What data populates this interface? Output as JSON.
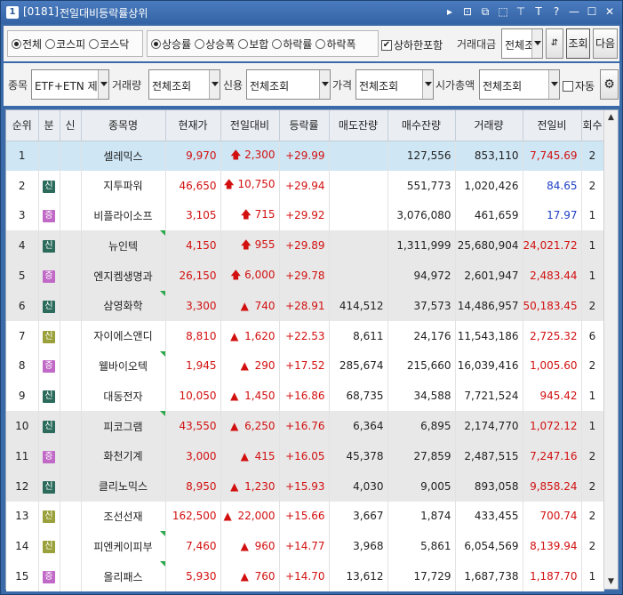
{
  "window": {
    "num": "1",
    "code": "[0181]",
    "title": "전일대비등락률상위"
  },
  "title_icons": [
    "▸",
    "⊡",
    "⧉",
    "⬚",
    "⊤",
    "T",
    "?",
    "—",
    "☐",
    "✕"
  ],
  "market_radios": [
    {
      "label": "전체",
      "on": true
    },
    {
      "label": "코스피",
      "on": false
    },
    {
      "label": "코스닥",
      "on": false
    }
  ],
  "sort_radios": [
    {
      "label": "상승률",
      "on": true
    },
    {
      "label": "상승폭",
      "on": false
    },
    {
      "label": "보합",
      "on": false
    },
    {
      "label": "하락률",
      "on": false
    },
    {
      "label": "하락폭",
      "on": false
    }
  ],
  "include_limit_label": "상하한포함",
  "trade_value_label": "거래대금",
  "trade_value_select": "전체조",
  "search_button": "조회",
  "next_button": "다음",
  "filters": {
    "item_label": "종목",
    "item_value": "ETF+ETN 제외",
    "volume_label": "거래량",
    "volume_value": "전체조회",
    "credit_label": "신용",
    "credit_value": "전체조회",
    "price_label": "가격",
    "price_value": "전체조회",
    "cap_label": "시가총액",
    "cap_value": "전체조회",
    "auto_label": "자동"
  },
  "columns": [
    "순위",
    "분",
    "신",
    "종목명",
    "현재가",
    "전일대비",
    "등락률",
    "매도잔량",
    "매수잔량",
    "거래량",
    "전일비",
    "회수"
  ],
  "rows": [
    {
      "rank": "1",
      "badge": "",
      "name": "셀레믹스",
      "flag": false,
      "price": "9,970",
      "arrow": "up",
      "change": "2,300",
      "rate": "+29.99",
      "ask": "",
      "bid": "127,556",
      "volume": "853,110",
      "prev": "7,745.69",
      "prev_up": true,
      "count": "2"
    },
    {
      "rank": "2",
      "badge": "신",
      "name": "지투파워",
      "flag": false,
      "price": "46,650",
      "arrow": "up",
      "change": "10,750",
      "rate": "+29.94",
      "ask": "",
      "bid": "551,773",
      "volume": "1,020,426",
      "prev": "84.65",
      "prev_up": false,
      "count": "2"
    },
    {
      "rank": "3",
      "badge": "증",
      "name": "비플라이소프",
      "flag": false,
      "price": "3,105",
      "arrow": "up",
      "change": "715",
      "rate": "+29.92",
      "ask": "",
      "bid": "3,076,080",
      "volume": "461,659",
      "prev": "17.97",
      "prev_up": false,
      "count": "1"
    },
    {
      "rank": "4",
      "badge": "신",
      "name": "뉴인텍",
      "flag": true,
      "price": "4,150",
      "arrow": "up",
      "change": "955",
      "rate": "+29.89",
      "ask": "",
      "bid": "1,311,999",
      "volume": "25,680,904",
      "prev": "24,021.72",
      "prev_up": true,
      "count": "1"
    },
    {
      "rank": "5",
      "badge": "증",
      "name": "엔지켐생명과",
      "flag": false,
      "price": "26,150",
      "arrow": "up",
      "change": "6,000",
      "rate": "+29.78",
      "ask": "",
      "bid": "94,972",
      "volume": "2,601,947",
      "prev": "2,483.44",
      "prev_up": true,
      "count": "1"
    },
    {
      "rank": "6",
      "badge": "신",
      "name": "삼영화학",
      "flag": true,
      "price": "3,300",
      "arrow": "tri",
      "change": "740",
      "rate": "+28.91",
      "ask": "414,512",
      "bid": "37,573",
      "volume": "14,486,957",
      "prev": "50,183.45",
      "prev_up": true,
      "count": "2"
    },
    {
      "rank": "7",
      "badge": "신y",
      "name": "자이에스앤디",
      "flag": false,
      "price": "8,810",
      "arrow": "tri",
      "change": "1,620",
      "rate": "+22.53",
      "ask": "8,611",
      "bid": "24,176",
      "volume": "11,543,186",
      "prev": "2,725.32",
      "prev_up": true,
      "count": "6"
    },
    {
      "rank": "8",
      "badge": "증",
      "name": "웰바이오텍",
      "flag": true,
      "price": "1,945",
      "arrow": "tri",
      "change": "290",
      "rate": "+17.52",
      "ask": "285,674",
      "bid": "215,660",
      "volume": "16,039,416",
      "prev": "1,005.60",
      "prev_up": true,
      "count": "2"
    },
    {
      "rank": "9",
      "badge": "신",
      "name": "대동전자",
      "flag": false,
      "price": "10,050",
      "arrow": "tri",
      "change": "1,450",
      "rate": "+16.86",
      "ask": "68,735",
      "bid": "34,588",
      "volume": "7,721,524",
      "prev": "945.42",
      "prev_up": true,
      "count": "1"
    },
    {
      "rank": "10",
      "badge": "신",
      "name": "피코그램",
      "flag": true,
      "price": "43,550",
      "arrow": "tri",
      "change": "6,250",
      "rate": "+16.76",
      "ask": "6,364",
      "bid": "6,895",
      "volume": "2,174,770",
      "prev": "1,072.12",
      "prev_up": true,
      "count": "1"
    },
    {
      "rank": "11",
      "badge": "증",
      "name": "화천기계",
      "flag": false,
      "price": "3,000",
      "arrow": "tri",
      "change": "415",
      "rate": "+16.05",
      "ask": "45,378",
      "bid": "27,859",
      "volume": "2,487,515",
      "prev": "7,247.16",
      "prev_up": true,
      "count": "2"
    },
    {
      "rank": "12",
      "badge": "신",
      "name": "클리노믹스",
      "flag": false,
      "price": "8,950",
      "arrow": "tri",
      "change": "1,230",
      "rate": "+15.93",
      "ask": "4,030",
      "bid": "9,005",
      "volume": "893,058",
      "prev": "9,858.24",
      "prev_up": true,
      "count": "2"
    },
    {
      "rank": "13",
      "badge": "신y",
      "name": "조선선재",
      "flag": false,
      "price": "162,500",
      "arrow": "tri",
      "change": "22,000",
      "rate": "+15.66",
      "ask": "3,667",
      "bid": "1,874",
      "volume": "433,455",
      "prev": "700.74",
      "prev_up": true,
      "count": "2"
    },
    {
      "rank": "14",
      "badge": "신y",
      "name": "피엔케이피부",
      "flag": true,
      "price": "7,460",
      "arrow": "tri",
      "change": "960",
      "rate": "+14.77",
      "ask": "3,968",
      "bid": "5,861",
      "volume": "6,054,569",
      "prev": "8,139.94",
      "prev_up": true,
      "count": "2"
    },
    {
      "rank": "15",
      "badge": "증",
      "name": "올리패스",
      "flag": true,
      "price": "5,930",
      "arrow": "tri",
      "change": "760",
      "rate": "+14.70",
      "ask": "13,612",
      "bid": "17,729",
      "volume": "1,687,738",
      "prev": "1,187.70",
      "prev_up": true,
      "count": "1"
    }
  ],
  "colors": {
    "up": "#d21010",
    "down": "#1f3fc4",
    "selected_row": "#cfe6f5"
  }
}
